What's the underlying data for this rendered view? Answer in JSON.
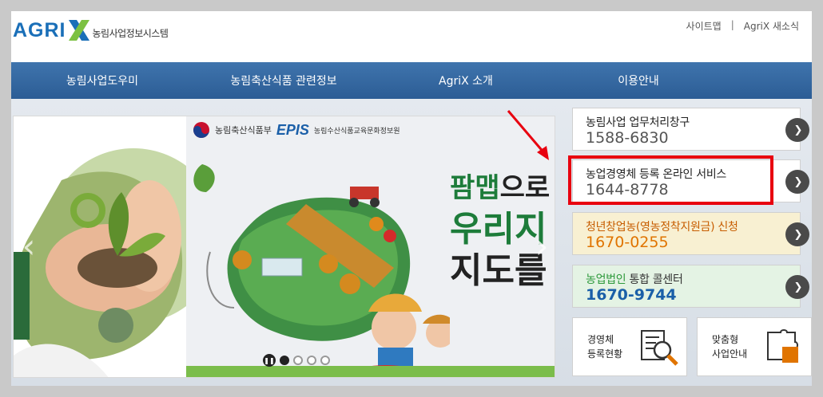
{
  "header": {
    "logo_text": "AGRIX",
    "logo_subtitle": "농림사업정보시스템",
    "util_links": [
      "사이트맵",
      "AgriX 새소식"
    ],
    "util_separator": "|"
  },
  "nav": {
    "items": [
      "농림사업도우미",
      "농림축산식품 관련정보",
      "AgriX 소개",
      "이용안내"
    ]
  },
  "banner": {
    "org1": "농림축산식품부",
    "org2_logo": "EPIS",
    "org2": "농림수산식품교육문화정보원",
    "headline_1a": "팜맵",
    "headline_1b": "으로",
    "headline_2": "우리지",
    "headline_3": "지도를",
    "slide_count": 4,
    "active_slide": 1
  },
  "services": [
    {
      "title": "농림사업 업무처리창구",
      "phone": "1588-6830"
    },
    {
      "title": "농업경영체 등록 온라인 서비스",
      "phone": "1644-8778"
    },
    {
      "title": "청년창업농(영농정착지원금) 신청",
      "phone": "1670-0255"
    },
    {
      "title_a": "농업법인",
      "title_b": " 통합 콜센터",
      "phone": "1670-9744"
    }
  ],
  "tiles": [
    {
      "line1": "경영체",
      "line2": "등록현황",
      "icon": "magnifier-document-icon"
    },
    {
      "line1": "맞춤형",
      "line2": "사업안내",
      "icon": "puzzle-icon"
    }
  ],
  "colors": {
    "nav": "#2c5d95",
    "highlight": "#e8000f",
    "brand_blue": "#1a6fb8",
    "brand_green": "#7cc142"
  }
}
